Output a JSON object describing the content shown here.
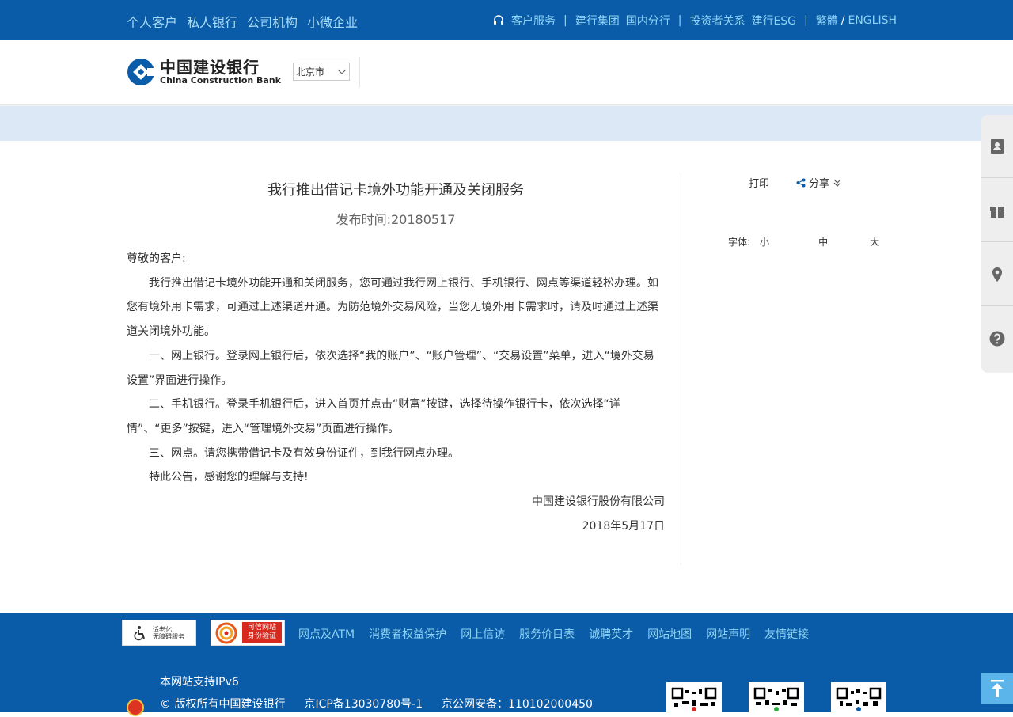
{
  "topnav": {
    "left": [
      "个人客户",
      "私人银行",
      "公司机构",
      "小微企业"
    ],
    "service": "客户服务",
    "group": "建行集团",
    "branch": "国内分行",
    "investor": "投资者关系",
    "esg": "建行ESG",
    "trad": "繁體",
    "slash": "/",
    "english": "ENGLISH",
    "sep": "|"
  },
  "header": {
    "logo_cn": "中国建设银行",
    "logo_en": "China Construction Bank",
    "city": "北京市"
  },
  "article": {
    "title": "我行推出借记卡境外功能开通及关闭服务",
    "date_label": "发布时间:",
    "date_value": "20180517",
    "greeting": "尊敬的客户:",
    "p1": "我行推出借记卡境外功能开通和关闭服务，您可通过我行网上银行、手机银行、网点等渠道轻松办理。如您有境外用卡需求，可通过上述渠道开通。为防范境外交易风险，当您无境外用卡需求时，请及时通过上述渠道关闭境外功能。",
    "p2": "一、网上银行。登录网上银行后，依次选择“我的账户”、“账户管理”、“交易设置”菜单，进入“境外交易设置”界面进行操作。",
    "p3": "二、手机银行。登录手机银行后，进入首页并点击“财富”按键，选择待操作银行卡，依次选择“详情”、“更多”按键，进入“管理境外交易”页面进行操作。",
    "p4": "三、网点。请您携带借记卡及有效身份证件，到我行网点办理。",
    "p5": "特此公告，感谢您的理解与支持!",
    "sign_org": "中国建设银行股份有限公司",
    "sign_date": "2018年5月17日"
  },
  "sidebar": {
    "print": "打印",
    "share": "分享",
    "font_label": "字体:",
    "font_small": "小",
    "font_mid": "中",
    "font_large": "大"
  },
  "float_panel": {
    "icons": [
      "contact-card-icon",
      "gift-icon",
      "location-pin-icon",
      "help-icon"
    ]
  },
  "footer": {
    "badge_accessible_1": "适老化",
    "badge_accessible_2": "无障碍服务",
    "badge_trust_1": "可信网站",
    "badge_trust_2": "身份验证",
    "links": [
      "网点及ATM",
      "消费者权益保护",
      "网上信访",
      "服务价目表",
      "诚聘英才",
      "网站地图",
      "网站声明",
      "友情链接"
    ],
    "ipv6": "本网站支持IPv6",
    "copyright": "© 版权所有中国建设银行",
    "icp": "京ICP备13030780号-1",
    "police": "京公网安备：110102000450"
  },
  "colors": {
    "brand_blue": "#0a5ca8",
    "link_light": "#8fd4f5",
    "band": "#dce8f6"
  }
}
